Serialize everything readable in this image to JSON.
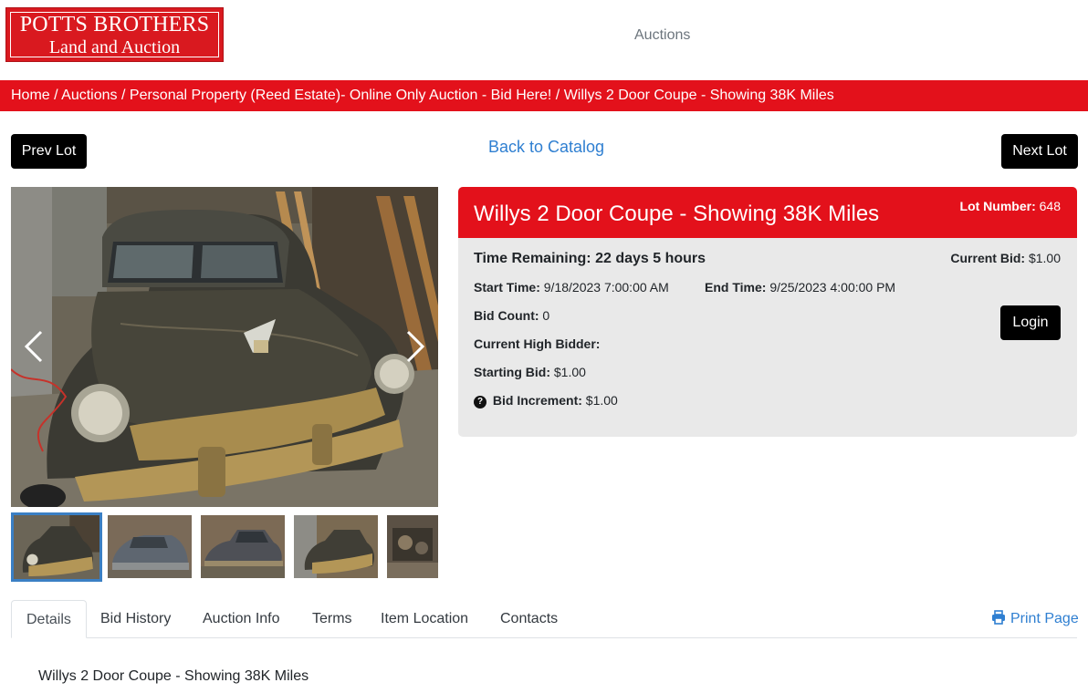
{
  "header": {
    "logo_line1": "POTTS BROTHERS",
    "logo_line2": "Land and Auction",
    "nav_auctions": "Auctions"
  },
  "breadcrumb": {
    "items": [
      "Home",
      "Auctions",
      "Personal Property (Reed Estate)- Online Only Auction - Bid Here!",
      "Willys 2 Door Coupe - Showing 38K Miles"
    ],
    "separator": "/"
  },
  "lot_nav": {
    "prev": "Prev Lot",
    "back": "Back to Catalog",
    "next": "Next Lot"
  },
  "lot": {
    "title": "Willys 2 Door Coupe - Showing 38K Miles",
    "lot_number_label": "Lot Number:",
    "lot_number": "648",
    "time_remaining_label": "Time Remaining:",
    "time_remaining": "22 days 5 hours",
    "current_bid_label": "Current Bid:",
    "current_bid": "$1.00",
    "start_time_label": "Start Time:",
    "start_time": "9/18/2023 7:00:00 AM",
    "end_time_label": "End Time:",
    "end_time": "9/25/2023 4:00:00 PM",
    "bid_count_label": "Bid Count:",
    "bid_count": "0",
    "high_bidder_label": "Current High Bidder:",
    "high_bidder": "",
    "starting_bid_label": "Starting Bid:",
    "starting_bid": "$1.00",
    "bid_increment_label": "Bid Increment:",
    "bid_increment": "$1.00",
    "login": "Login"
  },
  "tabs": {
    "items": [
      "Details",
      "Bid History",
      "Auction Info",
      "Terms",
      "Item Location",
      "Contacts"
    ],
    "active": "Details",
    "print": "Print Page"
  },
  "details": {
    "description": "Willys 2 Door Coupe - Showing 38K Miles"
  },
  "icons": {
    "help": "question-circle-icon",
    "print": "printer-icon",
    "prev": "chevron-left-icon",
    "next": "chevron-right-icon"
  },
  "colors": {
    "brand_red": "#e3111b",
    "link_blue": "#2f7fd1",
    "panel_gray": "#e9e9e9"
  }
}
